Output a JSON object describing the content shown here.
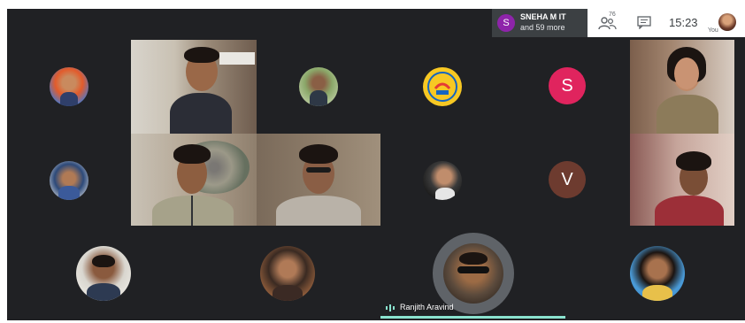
{
  "notification": {
    "initial": "S",
    "line1": "SNEHA M IT",
    "line2": "and 59 more",
    "color": "#8e24aa"
  },
  "topbar": {
    "participant_count": "76",
    "time": "15:23",
    "self_label": "You"
  },
  "tiles": {
    "s_initial": "S",
    "v_initial": "V",
    "s_color": "#e0245e",
    "v_color": "#6d3b2f"
  },
  "active_speaker": {
    "name": "Ranjith Aravind"
  },
  "colors": {
    "background": "#202124",
    "speaking_accent": "#8ae3cf"
  }
}
